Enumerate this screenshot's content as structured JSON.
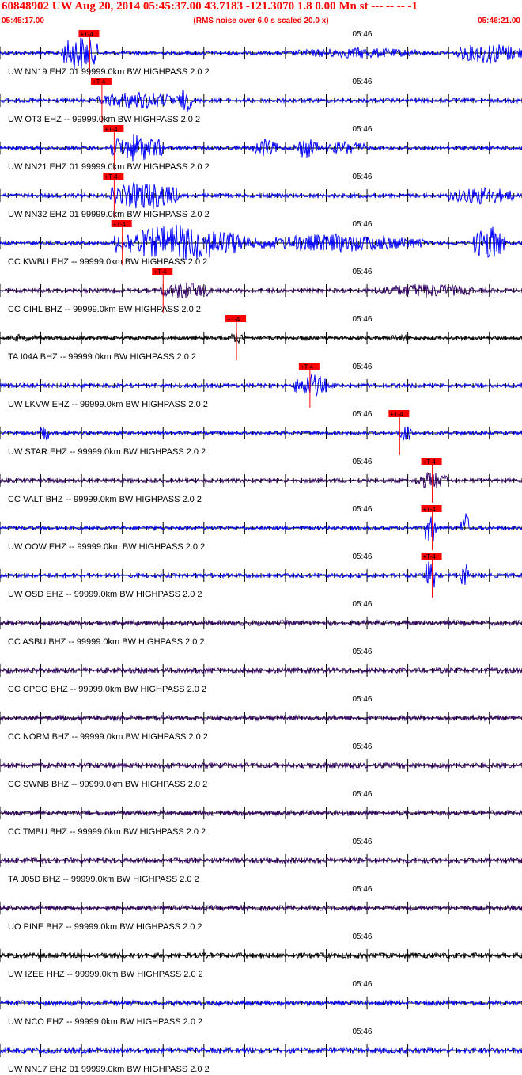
{
  "header": {
    "title": "60848902 UW Aug 20, 2014 05:45:37.00   43.7183 -121.3070  1.8 0.00 Mn st --- -- --   -1",
    "start_time": "05:45:17.00",
    "rms_note": "(RMS noise over 6.0 s scaled 20.0 x)",
    "end_time": "05:46:21.00"
  },
  "colors": {
    "header_text": "#ff0000",
    "pick": "#ff0000",
    "grid": "#000000",
    "trace_blue": "#0000ff",
    "trace_dark": "#330066",
    "trace_black": "#000000"
  },
  "chart_data": {
    "type": "line",
    "title": "60848902 UW Aug 20, 2014 05:45:37.00   43.7183 -121.3070  1.8 0.00 Mn st --- -- --   -1",
    "x_range": [
      "05:45:17.00",
      "05:46:21.00"
    ],
    "x_range_seconds": [
      0,
      64
    ],
    "tick_label": "05:46",
    "tick_label_second": 43,
    "pick_label": "+T-4",
    "series": [
      {
        "name": "UW NN19 EHZ 01 99999.0km BW  HIGHPASS  2.0  2",
        "color": "blue",
        "pick_second": 11.0,
        "activity": [
          [
            7.5,
            12,
            1.0
          ],
          [
            36,
            52,
            0.3
          ],
          [
            56,
            64,
            0.6
          ]
        ]
      },
      {
        "name": "UW OT3 EHZ -- 99999.0km BW  HIGHPASS  2.0  2",
        "color": "blue",
        "pick_second": 12.5,
        "activity": [
          [
            12,
            22,
            0.5
          ],
          [
            22,
            23.5,
            0.7
          ]
        ]
      },
      {
        "name": "UW NN21 EHZ 01 99999.0km BW  HIGHPASS  2.0  2",
        "color": "blue",
        "pick_second": 14.0,
        "activity": [
          [
            13.5,
            20,
            0.8
          ],
          [
            31,
            34,
            0.5
          ],
          [
            36,
            39,
            0.6
          ],
          [
            40,
            45,
            0.4
          ]
        ]
      },
      {
        "name": "UW NN32 EHZ 01 99999.0km BW  HIGHPASS  2.0  2",
        "color": "blue",
        "pick_second": 14.0,
        "activity": [
          [
            13.5,
            22,
            0.8
          ],
          [
            55,
            63,
            0.5
          ]
        ]
      },
      {
        "name": "CC KWBU EHZ -- 99999.0km BW  HIGHPASS  2.0  2",
        "color": "blue",
        "pick_second": 15.0,
        "activity": [
          [
            14,
            30,
            1.0
          ],
          [
            30,
            52,
            0.5
          ],
          [
            58,
            62,
            1.0
          ]
        ]
      },
      {
        "name": "CC CIHL BHZ -- 99999.0km BW  HIGHPASS  2.0  2",
        "color": "dark",
        "pick_second": 20.0,
        "activity": [
          [
            19.5,
            26,
            0.5
          ],
          [
            46,
            58,
            0.4
          ]
        ]
      },
      {
        "name": "TA I04A BHZ -- 99999.0km BW  HIGHPASS  2.0  2",
        "color": "black",
        "pick_second": 29.0,
        "activity": [
          [
            0,
            5,
            0.2
          ],
          [
            28,
            30,
            0.3
          ],
          [
            47,
            51,
            0.2
          ]
        ]
      },
      {
        "name": "UW LKVW EHZ -- 99999.0km BW  HIGHPASS  2.0  2",
        "color": "blue",
        "pick_second": 38.0,
        "activity": [
          [
            36,
            40,
            0.7
          ]
        ]
      },
      {
        "name": "UW STAR EHZ -- 99999.0km BW  HIGHPASS  2.0  2",
        "color": "blue",
        "pick_second": 49.0,
        "activity": [
          [
            5,
            6,
            0.5
          ],
          [
            49,
            50.5,
            0.6
          ]
        ]
      },
      {
        "name": "CC VALT BHZ -- 99999.0km BW  HIGHPASS  2.0  2",
        "color": "dark",
        "pick_second": 53.0,
        "activity": [
          [
            51,
            55,
            0.5
          ]
        ]
      },
      {
        "name": "UW OOW EHZ -- 99999.0km BW  HIGHPASS  2.0  2",
        "color": "blue",
        "pick_second": 53.0,
        "activity": [
          [
            52,
            53.5,
            1.0
          ],
          [
            56.5,
            57.5,
            1.0
          ]
        ]
      },
      {
        "name": "UW OSD EHZ -- 99999.0km BW  HIGHPASS  2.0  2",
        "color": "blue",
        "pick_second": 53.0,
        "activity": [
          [
            52,
            53.5,
            1.0
          ],
          [
            56.5,
            57.5,
            0.8
          ]
        ]
      },
      {
        "name": "CC ASBU BHZ -- 99999.0km BW  HIGHPASS  2.0  2",
        "color": "dark",
        "activity": []
      },
      {
        "name": "CC CPCO BHZ -- 99999.0km BW  HIGHPASS  2.0  2",
        "color": "dark",
        "activity": []
      },
      {
        "name": "CC NORM BHZ -- 99999.0km BW  HIGHPASS  2.0  2",
        "color": "dark",
        "activity": []
      },
      {
        "name": "CC SWNB BHZ -- 99999.0km BW  HIGHPASS  2.0  2",
        "color": "dark",
        "activity": []
      },
      {
        "name": "CC TMBU BHZ -- 99999.0km BW  HIGHPASS  2.0  2",
        "color": "dark",
        "activity": []
      },
      {
        "name": "TA J05D BHZ -- 99999.0km BW  HIGHPASS  2.0  2",
        "color": "dark",
        "activity": []
      },
      {
        "name": "UO PINE BHZ -- 99999.0km BW  HIGHPASS  2.0  2",
        "color": "dark",
        "activity": []
      },
      {
        "name": "UW IZEE HHZ -- 99999.0km BW  HIGHPASS  2.0  2",
        "color": "black",
        "activity": []
      },
      {
        "name": "UW NCO EHZ -- 99999.0km BW  HIGHPASS  2.0  2",
        "color": "blue",
        "activity": []
      },
      {
        "name": "UW NN17 EHZ 01 99999.0km BW  HIGHPASS  2.0  2",
        "color": "blue",
        "activity": []
      }
    ]
  }
}
